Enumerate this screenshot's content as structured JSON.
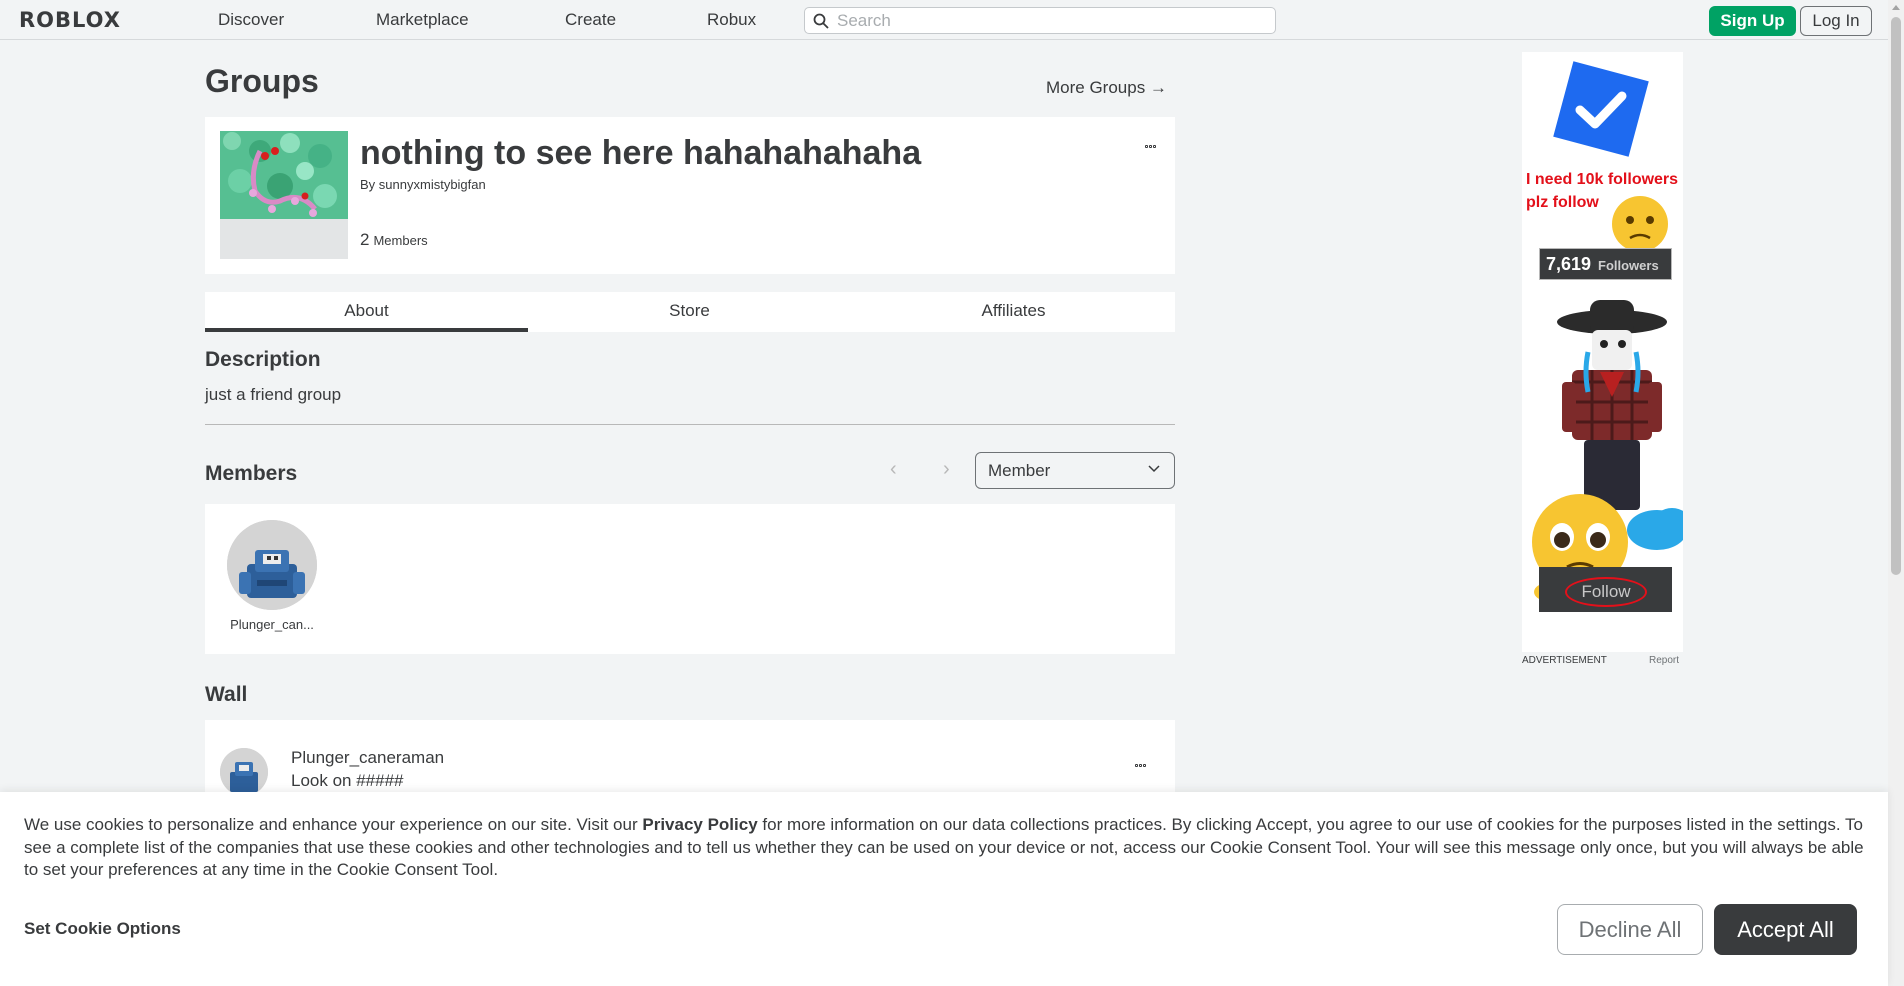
{
  "nav": {
    "logo": "ROBLOX",
    "links": [
      "Discover",
      "Marketplace",
      "Create",
      "Robux"
    ],
    "search_placeholder": "Search",
    "sign_up": "Sign Up",
    "log_in": "Log In"
  },
  "page": {
    "title": "Groups",
    "more_groups": "More Groups →"
  },
  "group": {
    "name": "nothing to see here hahahahahaha",
    "by_label": "By",
    "owner": "sunnyxmistybigfan",
    "member_count": "2",
    "members_label": "Members"
  },
  "tabs": [
    "About",
    "Store",
    "Affiliates"
  ],
  "description": {
    "title": "Description",
    "text": "just a friend group"
  },
  "members": {
    "title": "Members",
    "role_selected": "Member",
    "list": [
      {
        "name": "Plunger_can..."
      }
    ]
  },
  "wall": {
    "title": "Wall",
    "posts": [
      {
        "user": "Plunger_caneraman",
        "message": "Look on #####"
      }
    ]
  },
  "ad": {
    "text_line1": "I need 10k followers",
    "text_line2": "plz follow",
    "followers_count": "7,619",
    "followers_label": "Followers",
    "follow_button": "Follow",
    "label": "ADVERTISEMENT",
    "report": "Report"
  },
  "cookie": {
    "text_before": "We use cookies to personalize and enhance your experience on our site. Visit our ",
    "privacy_link": "Privacy Policy",
    "text_after": " for more information on our data collections practices. By clicking Accept, you agree to our use of cookies for the purposes listed in the settings. To see a complete list of the companies that use these cookies and other technologies and to tell us whether they can be used on your device or not, access our Cookie Consent Tool. Your will see this message only once, but you will always be able to set your preferences at any time in the Cookie Consent Tool.",
    "set_options": "Set Cookie Options",
    "decline": "Decline All",
    "accept": "Accept All"
  },
  "colors": {
    "accent_green": "#00a264",
    "text_dark": "#393b3d",
    "background": "#f2f4f5",
    "ad_red": "#e3101a"
  }
}
